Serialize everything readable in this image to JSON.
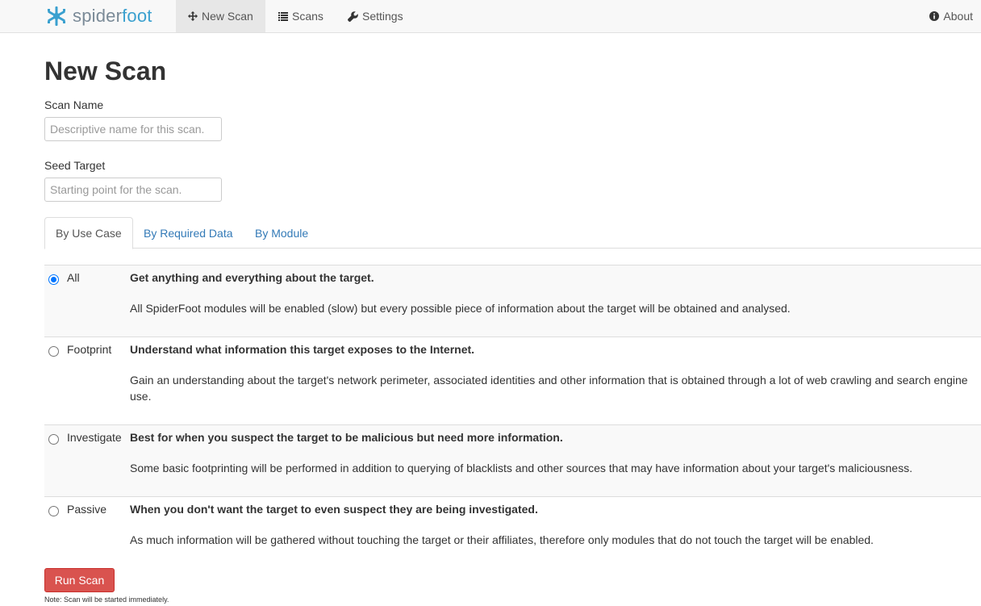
{
  "navbar": {
    "brand_main": "spider",
    "brand_accent": "foot",
    "items": [
      {
        "label": "New Scan",
        "icon": "move-icon",
        "active": true
      },
      {
        "label": "Scans",
        "icon": "list-icon",
        "active": false
      },
      {
        "label": "Settings",
        "icon": "wrench-icon",
        "active": false
      }
    ],
    "about_label": "About"
  },
  "page": {
    "title": "New Scan"
  },
  "form": {
    "scan_name_label": "Scan Name",
    "scan_name_placeholder": "Descriptive name for this scan.",
    "scan_name_value": "",
    "seed_target_label": "Seed Target",
    "seed_target_placeholder": "Starting point for the scan.",
    "seed_target_value": ""
  },
  "tabs": [
    {
      "label": "By Use Case",
      "active": true
    },
    {
      "label": "By Required Data",
      "active": false
    },
    {
      "label": "By Module",
      "active": false
    }
  ],
  "use_cases": [
    {
      "name": "All",
      "selected": true,
      "headline": "Get anything and everything about the target.",
      "description": "All SpiderFoot modules will be enabled (slow) but every possible piece of information about the target will be obtained and analysed."
    },
    {
      "name": "Footprint",
      "selected": false,
      "headline": "Understand what information this target exposes to the Internet.",
      "description": "Gain an understanding about the target's network perimeter, associated identities and other information that is obtained through a lot of web crawling and search engine use."
    },
    {
      "name": "Investigate",
      "selected": false,
      "headline": "Best for when you suspect the target to be malicious but need more information.",
      "description": "Some basic footprinting will be performed in addition to querying of blacklists and other sources that may have information about your target's maliciousness."
    },
    {
      "name": "Passive",
      "selected": false,
      "headline": "When you don't want the target to even suspect they are being investigated.",
      "description": "As much information will be gathered without touching the target or their affiliates, therefore only modules that do not touch the target will be enabled."
    }
  ],
  "actions": {
    "run_label": "Run Scan",
    "note": "Note: Scan will be started immediately."
  },
  "colors": {
    "link": "#337ab7",
    "danger": "#d9534f",
    "brand_accent": "#3aa0cf"
  }
}
